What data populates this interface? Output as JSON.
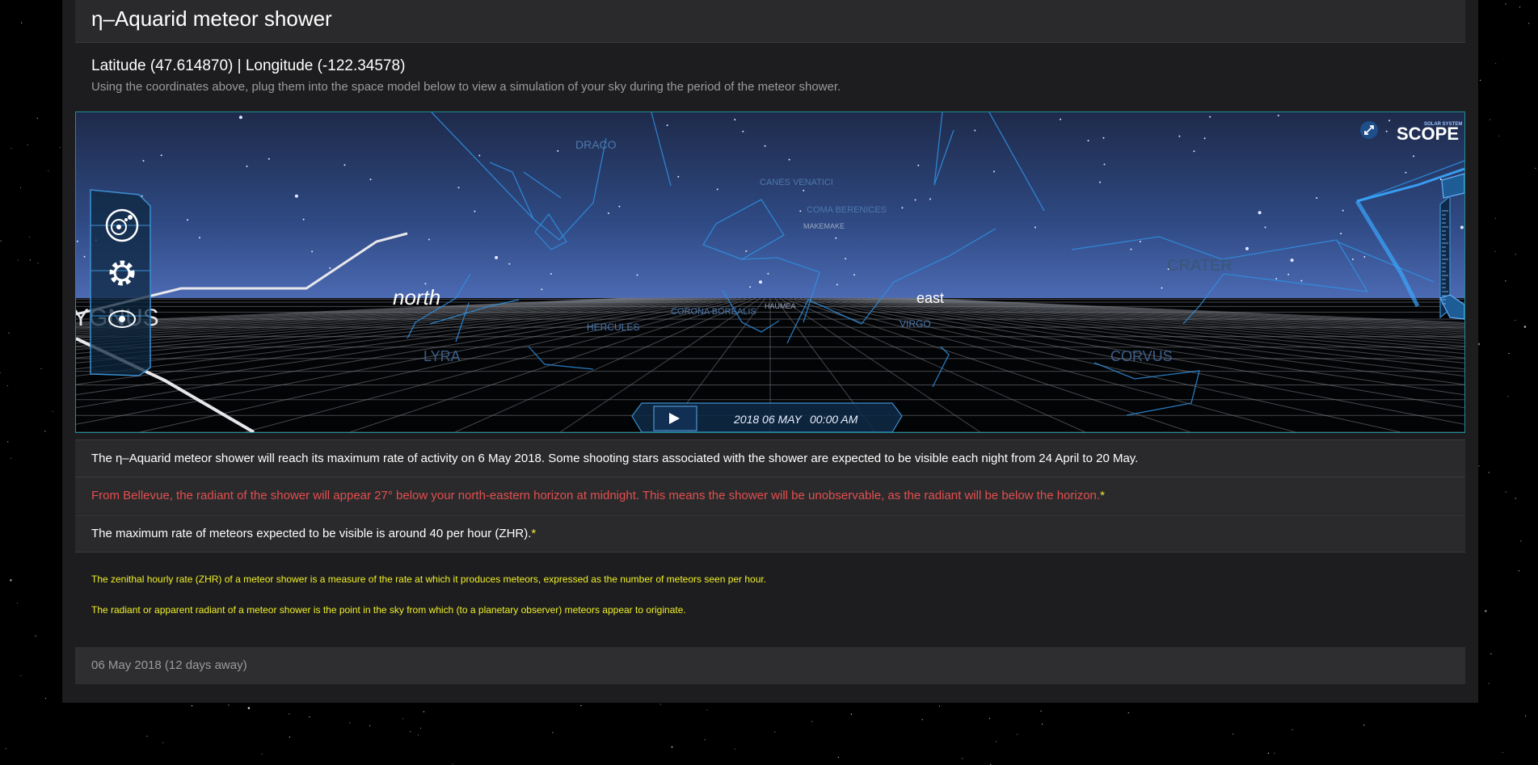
{
  "page": {
    "title": "η–Aquarid meteor shower",
    "coordinates": "Latitude (47.614870) | Longitude (-122.34578)",
    "instructions": "Using the coordinates above, plug them into the space model below to view a simulation of your sky during the period of the meteor shower."
  },
  "simulator": {
    "brand_small": "SOLAR SYSTEM",
    "brand": "SCOPE",
    "directions": {
      "north": "north",
      "east": "east"
    },
    "constellations": [
      "DRACO",
      "CANES VENATICI",
      "COMA BERENICES",
      "MAKEMAKE",
      "CRATER",
      "HAUMEA",
      "CORONA BOREALIS",
      "HERCULES",
      "VIRGO",
      "LYRA",
      "CORVUS",
      "YGNUS"
    ],
    "date": "2018 06 MAY",
    "time": "00:00 AM"
  },
  "info": {
    "line1": "The η–Aquarid meteor shower will reach its maximum rate of activity on 6 May 2018. Some shooting stars associated with the shower are expected to be visible each night from 24 April to 20 May.",
    "line2": "From Bellevue, the radiant of the shower will appear 27° below your north-eastern horizon at midnight. This means the shower will be unobservable, as the radiant will be below the horizon.",
    "line3": "The maximum rate of meteors expected to be visible is around 40 per hour (ZHR).",
    "asterisk": "*"
  },
  "notes": {
    "zhr": "The zenithal hourly rate (ZHR) of a meteor shower is a measure of the rate at which it produces meteors, expressed as the number of meteors seen per hour.",
    "radiant": "The radiant or apparent radiant of a meteor shower is the point in the sky from which (to a planetary observer) meteors appear to originate."
  },
  "footer": {
    "date": "06 May 2018 (12 days away)"
  },
  "colors": {
    "panel": "#1d1d1f",
    "row": "#2a2a2c",
    "red_text": "#e34e4e",
    "note_text": "#f0f02a",
    "sky_border": "#1e8e96",
    "constellation": "#2a8ad8"
  }
}
